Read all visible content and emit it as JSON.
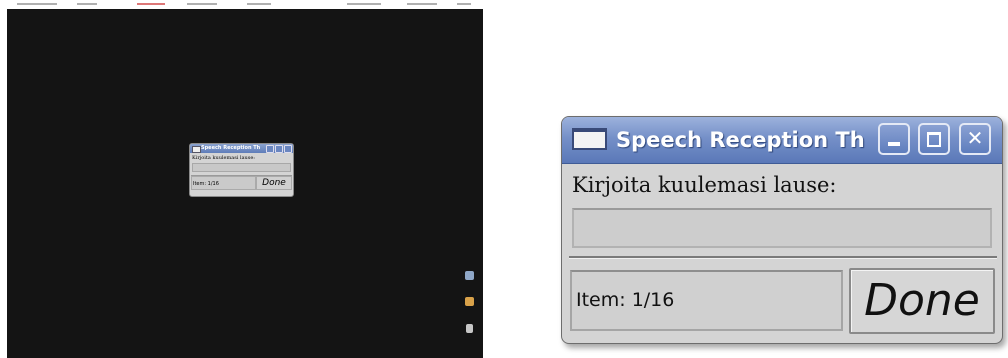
{
  "window": {
    "title": "Speech Reception Th",
    "prompt": "Kirjoita kuulemasi lause:",
    "answer_value": "",
    "item_label": "Item: 1/16",
    "done_label": "Done",
    "close_glyph": "✕"
  },
  "thumbnail": {
    "title": "Speech Reception Th",
    "prompt": "Kirjoita kuulemasi lause:",
    "item_label": "Item: 1/16",
    "done_label": "Done"
  },
  "colors": {
    "titlebar": "#7590c8",
    "dialog_bg": "#d4d4d4",
    "desktop_bg": "#141414"
  },
  "icons": [
    "app-window-icon",
    "minimize-icon",
    "maximize-icon",
    "close-icon"
  ]
}
